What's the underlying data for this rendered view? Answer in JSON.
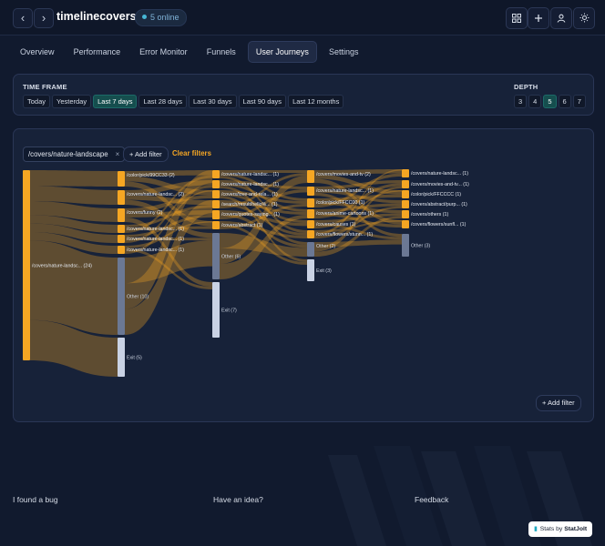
{
  "header": {
    "site": "timelinecovers.pro",
    "online": "5 online",
    "back_icon": "chevron-left-icon",
    "forward_icon": "chevron-right-icon",
    "actions": [
      "grid-icon",
      "plus-icon",
      "user-icon",
      "sun-icon"
    ]
  },
  "tabs": [
    {
      "label": "Overview",
      "active": false
    },
    {
      "label": "Performance",
      "active": false
    },
    {
      "label": "Error Monitor",
      "active": false
    },
    {
      "label": "Funnels",
      "active": false
    },
    {
      "label": "User Journeys",
      "active": true
    },
    {
      "label": "Settings",
      "active": false
    }
  ],
  "timeframe": {
    "label": "TIME FRAME",
    "options": [
      "Today",
      "Yesterday",
      "Last 7 days",
      "Last 28 days",
      "Last 30 days",
      "Last 90 days",
      "Last 12 months"
    ],
    "selected": "Last 7 days"
  },
  "depth": {
    "label": "DEPTH",
    "options": [
      "3",
      "4",
      "5",
      "6",
      "7"
    ],
    "selected": "5"
  },
  "filters": {
    "chip": "/covers/nature-landscape",
    "chip_close": "×",
    "add_filter": "+ Add filter",
    "clear": "Clear filters",
    "add_filter_bottom": "+ Add filter"
  },
  "colors": {
    "page_node": "#f5a623",
    "other_node": "#6b7894",
    "exit_node": "#c9d2e4",
    "link": "#f5a623",
    "accent": "#1c6a68"
  },
  "sankey": {
    "columns": [
      [
        {
          "label": "/covers/nature-landsc... (24)",
          "kind": "page"
        }
      ],
      [
        {
          "label": "/color/pick/99CC33 (2)",
          "kind": "page"
        },
        {
          "label": "/covers/nature-landsc... (2)",
          "kind": "page"
        },
        {
          "label": "/covers/funny (2)",
          "kind": "page"
        },
        {
          "label": "/covers/nature-landsc... (1)",
          "kind": "page"
        },
        {
          "label": "/covers/nature-landsc... (1)",
          "kind": "page"
        },
        {
          "label": "/covers/nature-landsc... (1)",
          "kind": "page"
        },
        {
          "label": "Other (10)",
          "kind": "other"
        },
        {
          "label": "Exit (5)",
          "kind": "exit"
        }
      ],
      [
        {
          "label": "/covers/nature-landsc... (1)",
          "kind": "page"
        },
        {
          "label": "/covers/nature-landsc... (1)",
          "kind": "page"
        },
        {
          "label": "/covers/love-and-rela... (1)",
          "kind": "page"
        },
        {
          "label": "/search/result/hello%... (1)",
          "kind": "page"
        },
        {
          "label": "/covers/quotes-saying... (1)",
          "kind": "page"
        },
        {
          "label": "/covers/abstract (1)",
          "kind": "page"
        },
        {
          "label": "Other (6)",
          "kind": "other"
        },
        {
          "label": "Exit (7)",
          "kind": "exit"
        }
      ],
      [
        {
          "label": "/covers/movies-and-tv (2)",
          "kind": "page"
        },
        {
          "label": "/covers/nature-landsc... (1)",
          "kind": "page"
        },
        {
          "label": "/color/pick/FFCC00 (1)",
          "kind": "page"
        },
        {
          "label": "/covers/anime-cartoons (1)",
          "kind": "page"
        },
        {
          "label": "/covers/causes (1)",
          "kind": "page"
        },
        {
          "label": "/covers/flowers/stunn... (1)",
          "kind": "page"
        },
        {
          "label": "Other (2)",
          "kind": "other"
        },
        {
          "label": "Exit (3)",
          "kind": "exit"
        }
      ],
      [
        {
          "label": "/covers/nature-landsc... (1)",
          "kind": "page"
        },
        {
          "label": "/covers/movies-and-tv... (1)",
          "kind": "page"
        },
        {
          "label": "/color/pick/FFCCCC (1)",
          "kind": "page"
        },
        {
          "label": "/covers/abstract/purp... (1)",
          "kind": "page"
        },
        {
          "label": "/covers/others (1)",
          "kind": "page"
        },
        {
          "label": "/covers/flowers/sunfl... (1)",
          "kind": "page"
        },
        {
          "label": "Other (3)",
          "kind": "other"
        }
      ]
    ]
  },
  "footer": {
    "bug": "I found a bug",
    "idea": "Have an idea?",
    "feedback": "Feedback",
    "stats_prefix": "Stats by",
    "stats_brand": "StatJolt",
    "stats_icon": "bar-chart-icon"
  }
}
